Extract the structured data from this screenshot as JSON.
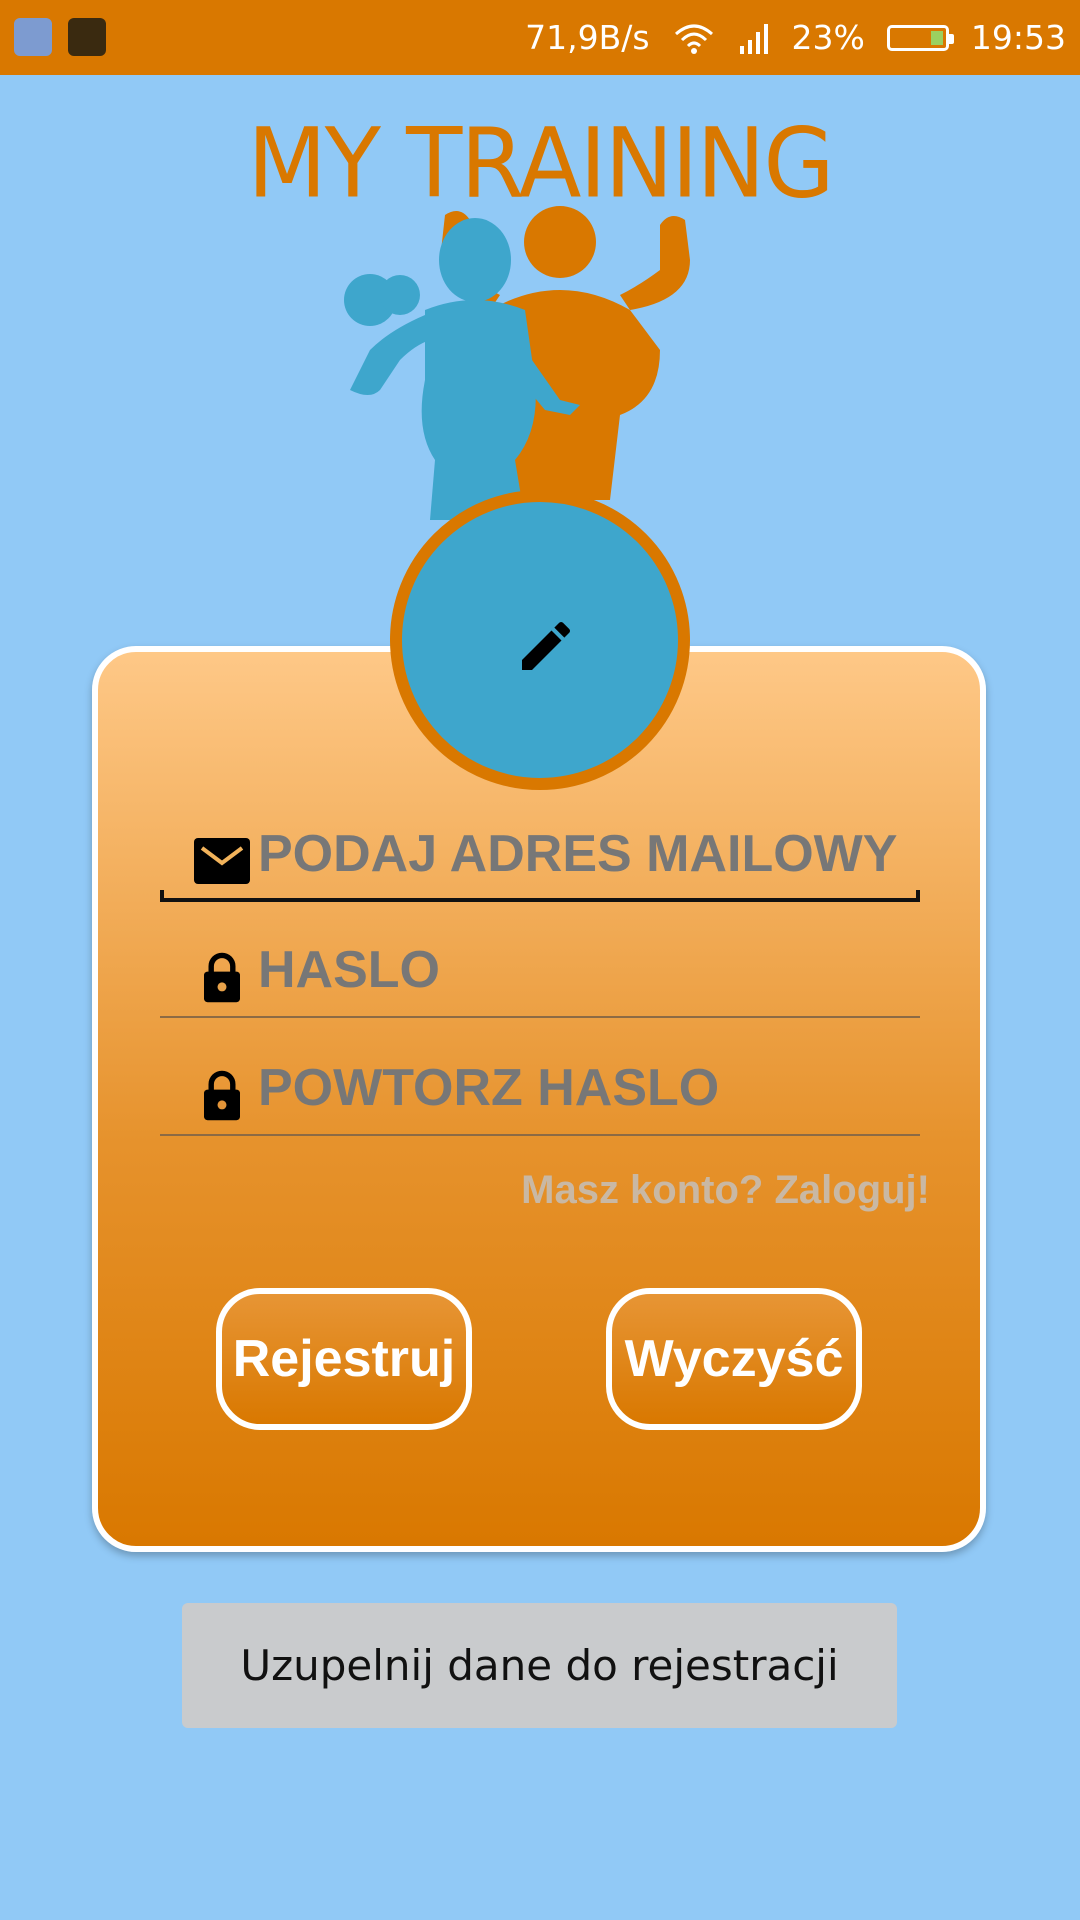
{
  "status_bar": {
    "network_speed": "71,9B/s",
    "battery_percent": "23%",
    "battery_level": 0.23,
    "time": "19:53",
    "icons": [
      "notification-app-icon",
      "weather-icon",
      "wifi-icon",
      "signal-icon",
      "battery-icon"
    ]
  },
  "logo": {
    "title": "MY TRAINING",
    "colors": {
      "accent": "#d97800",
      "figure_female": "#3ea6cc",
      "figure_male": "#d97800"
    }
  },
  "avatar": {
    "icon": "pencil-icon"
  },
  "form": {
    "email_placeholder": "PODAJ ADRES MAILOWY",
    "password_placeholder": "HASLO",
    "repeat_password_placeholder": "POWTORZ HASLO",
    "login_link": "Masz konto? Zaloguj!"
  },
  "buttons": {
    "register": "Rejestruj",
    "clear": "Wyczyść"
  },
  "toast": {
    "message": "Uzupelnij dane do rejestracji"
  },
  "colors": {
    "background": "#91c9f6",
    "primary": "#d97800",
    "card_top": "#fec887"
  }
}
